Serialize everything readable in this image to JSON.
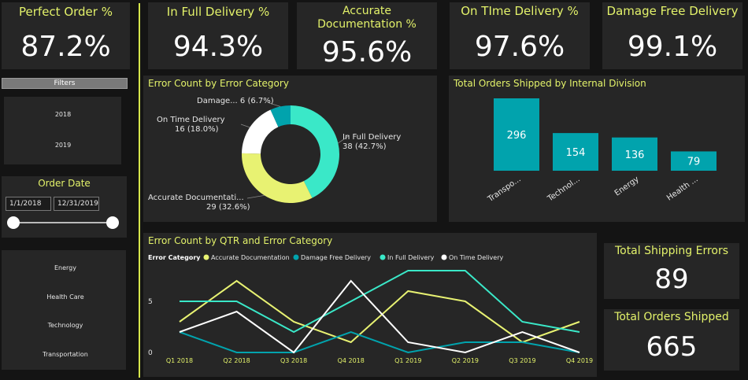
{
  "kpis": [
    {
      "title": "Perfect Order %",
      "value": "87.2%"
    },
    {
      "title": "In Full Delivery %",
      "value": "94.3%"
    },
    {
      "title": "Accurate Documentation %",
      "value": "95.6%"
    },
    {
      "title": "On TIme Delivery %",
      "value": "97.6%"
    },
    {
      "title": "Damage Free Delivery",
      "value": "99.1%"
    }
  ],
  "filters": {
    "header": "Filters",
    "years": [
      "2018",
      "2019"
    ]
  },
  "order_date": {
    "title": "Order Date",
    "start": "1/1/2018",
    "end": "12/31/2019"
  },
  "divisions_slicer": [
    "Energy",
    "Health Care",
    "Technology",
    "Transportation"
  ],
  "totals": {
    "errors_title": "Total Shipping Errors",
    "errors_value": "89",
    "shipped_title": "Total Orders Shipped",
    "shipped_value": "665"
  },
  "colors": {
    "accent": "#e3f26a",
    "teal": "#01a3ad",
    "mint": "#3ae8c8",
    "white": "#ffffff",
    "yellow": "#e8f272"
  },
  "chart_data": [
    {
      "type": "pie",
      "title": "Error Count by Error Category",
      "slices": [
        {
          "label": "In Full Delivery",
          "value": 38,
          "text": "38 (42.7%)",
          "color": "#3ae8c8"
        },
        {
          "label": "Accurate Documentati...",
          "value": 29,
          "text": "29 (32.6%)",
          "color": "#e8f272"
        },
        {
          "label": "On Time Delivery",
          "value": 16,
          "text": "16 (18.0%)",
          "color": "#ffffff"
        },
        {
          "label": "Damage...",
          "value": 6,
          "text": "6 (6.7%)",
          "color": "#01a3ad"
        }
      ]
    },
    {
      "type": "bar",
      "title": "Total Orders Shipped by Internal Division",
      "categories": [
        "Transpo...",
        "Technol...",
        "Energy",
        "Health ..."
      ],
      "values": [
        296,
        154,
        136,
        79
      ],
      "ylim": [
        0,
        296
      ]
    },
    {
      "type": "line",
      "title": "Error Count by QTR and Error Category",
      "legend_title": "Error Category",
      "x": [
        "Q1 2018",
        "Q2 2018",
        "Q3 2018",
        "Q4 2018",
        "Q1 2019",
        "Q2 2019",
        "Q3 2019",
        "Q4 2019"
      ],
      "yticks": [
        "0",
        "5"
      ],
      "ylim": [
        0,
        8
      ],
      "series": [
        {
          "name": "Accurate Documentation",
          "color": "#e8f272",
          "values": [
            3,
            7,
            3,
            1,
            6,
            5,
            1,
            3
          ]
        },
        {
          "name": "Damage Free Delivery",
          "color": "#01a3ad",
          "values": [
            2,
            0,
            0,
            2,
            0,
            1,
            1,
            0
          ]
        },
        {
          "name": "In Full Delivery",
          "color": "#3ae8c8",
          "values": [
            5,
            5,
            2,
            5,
            8,
            8,
            3,
            2
          ]
        },
        {
          "name": "On Time Delivery",
          "color": "#ffffff",
          "values": [
            2,
            4,
            0,
            7,
            1,
            0,
            2,
            0
          ]
        }
      ]
    }
  ]
}
